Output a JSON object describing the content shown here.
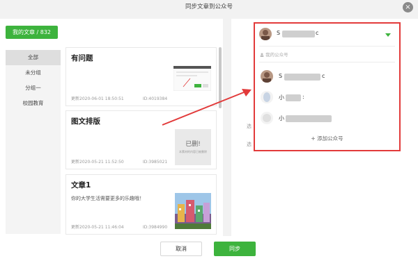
{
  "dialog": {
    "title": "同步文章到公众号",
    "close_label": "×"
  },
  "left": {
    "tab_label": "我的文章 / 832",
    "groups": [
      {
        "label": "全部",
        "active": true
      },
      {
        "label": "未分组"
      },
      {
        "label": "分组一"
      },
      {
        "label": "校园教育"
      }
    ],
    "articles": [
      {
        "title": "有问题",
        "desc": "",
        "date": "更新2020-06-01 18:50:51",
        "id": "ID:4019384"
      },
      {
        "title": "图文排版",
        "desc": "",
        "date": "更新2020-05-21 11:52:50",
        "id": "ID:3985021",
        "thumb_text_big": "已删!",
        "thumb_text_small": "本素材的内容已被删除"
      },
      {
        "title": "文章1",
        "desc": "你的大学生活需要更多的乐趣哦！",
        "date": "更新2020-05-21 11:46:04",
        "id": "ID:3984990"
      }
    ]
  },
  "right": {
    "side_labels": [
      "选",
      "选"
    ],
    "selected_account": {
      "name_start": "S",
      "name_end": "c"
    },
    "section_header": "我的公众号",
    "accounts": [
      {
        "name_start": "S",
        "name_end": "c"
      },
      {
        "name_start": "小",
        "name_end": ":"
      },
      {
        "name_start": "小",
        "name_end": ""
      }
    ],
    "add_label": "添加公众号",
    "add_icon": "+"
  },
  "footer": {
    "cancel_label": "取消",
    "sync_label": "同步"
  },
  "colors": {
    "brand_green": "#3db33d",
    "highlight_red": "#e23a3a"
  }
}
